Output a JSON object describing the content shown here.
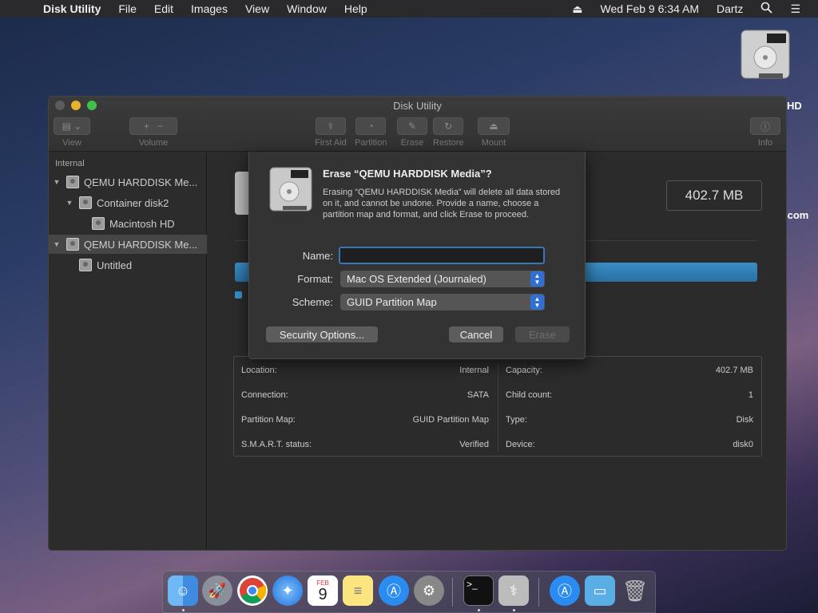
{
  "menubar": {
    "app_name": "Disk Utility",
    "items": [
      "File",
      "Edit",
      "Images",
      "View",
      "Window",
      "Help"
    ],
    "datetime": "Wed Feb 9  6:34 AM",
    "user": "Dartz"
  },
  "desktop": {
    "label_1": "HD",
    "label_2": ".com"
  },
  "window": {
    "title": "Disk Utility",
    "toolbar": {
      "view": "View",
      "volume": "Volume",
      "first_aid": "First Aid",
      "partition": "Partition",
      "erase": "Erase",
      "restore": "Restore",
      "mount": "Mount",
      "info": "Info"
    },
    "sidebar": {
      "section": "Internal",
      "items": [
        {
          "label": "QEMU HARDDISK Me..."
        },
        {
          "label": "Container disk2"
        },
        {
          "label": "Macintosh HD"
        },
        {
          "label": "QEMU HARDDISK Me..."
        },
        {
          "label": "Untitled"
        }
      ]
    },
    "main": {
      "size": "402.7 MB",
      "info": {
        "location_label": "Location:",
        "location_value": "Internal",
        "connection_label": "Connection:",
        "connection_value": "SATA",
        "partition_map_label": "Partition Map:",
        "partition_map_value": "GUID Partition Map",
        "smart_label": "S.M.A.R.T. status:",
        "smart_value": "Verified",
        "capacity_label": "Capacity:",
        "capacity_value": "402.7 MB",
        "child_count_label": "Child count:",
        "child_count_value": "1",
        "type_label": "Type:",
        "type_value": "Disk",
        "device_label": "Device:",
        "device_value": "disk0"
      }
    }
  },
  "dialog": {
    "title": "Erase “QEMU HARDDISK Media”?",
    "message": "Erasing “QEMU HARDDISK Media” will delete all data stored on it, and cannot be undone. Provide a name, choose a partition map and format, and click Erase to proceed.",
    "name_label": "Name:",
    "name_value": "",
    "format_label": "Format:",
    "format_value": "Mac OS Extended (Journaled)",
    "scheme_label": "Scheme:",
    "scheme_value": "GUID Partition Map",
    "security_button": "Security Options...",
    "cancel_button": "Cancel",
    "erase_button": "Erase"
  },
  "dock": {
    "calendar_month": "FEB",
    "calendar_day": "9"
  },
  "colors": {
    "accent": "#2f6fd6",
    "bar": "#3a8ec6"
  }
}
